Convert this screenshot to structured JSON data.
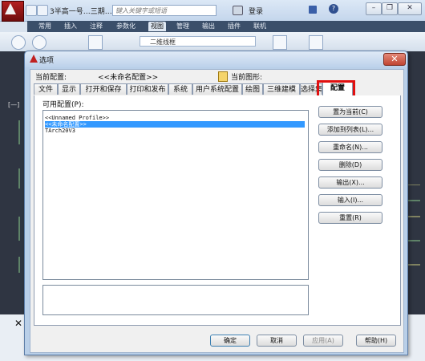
{
  "app": {
    "title": "3半高一号…三期…",
    "search_placeholder": "键入关键字或短语",
    "signin": "登录",
    "ribbon_tabs": [
      "常用",
      "插入",
      "注释",
      "参数化",
      "视图",
      "管理",
      "输出",
      "插件",
      "联机"
    ],
    "visual_style": "二维线框",
    "drawing_label": "[—]"
  },
  "dialog": {
    "title": "选项",
    "current_profile_label": "当前配置:",
    "current_profile_value": "<<未命名配置>>",
    "current_drawing_label": "当前图形:",
    "tabs": [
      "文件",
      "显示",
      "打开和保存",
      "打印和发布",
      "系统",
      "用户系统配置",
      "绘图",
      "三维建模",
      "选择集",
      "配置"
    ],
    "active_tab": "配置",
    "available_profiles_label": "可用配置(P):",
    "profiles": [
      "<<Unnamed Profile>>",
      "<<未命名配置>>",
      "TArch20V3"
    ],
    "selected_profile_index": 1,
    "side_buttons": {
      "set_current": "置为当前(C)",
      "add_to_list": "添加到列表(L)...",
      "rename": "重命名(N)...",
      "delete": "删除(D)",
      "export": "输出(X)...",
      "import": "输入(I)...",
      "reset": "重置(R)"
    },
    "footer_buttons": {
      "ok": "确定",
      "cancel": "取消",
      "apply": "应用(A)",
      "help": "帮助(H)"
    }
  },
  "colors": {
    "highlight_box": "#e01010",
    "selection": "#3399ff"
  }
}
